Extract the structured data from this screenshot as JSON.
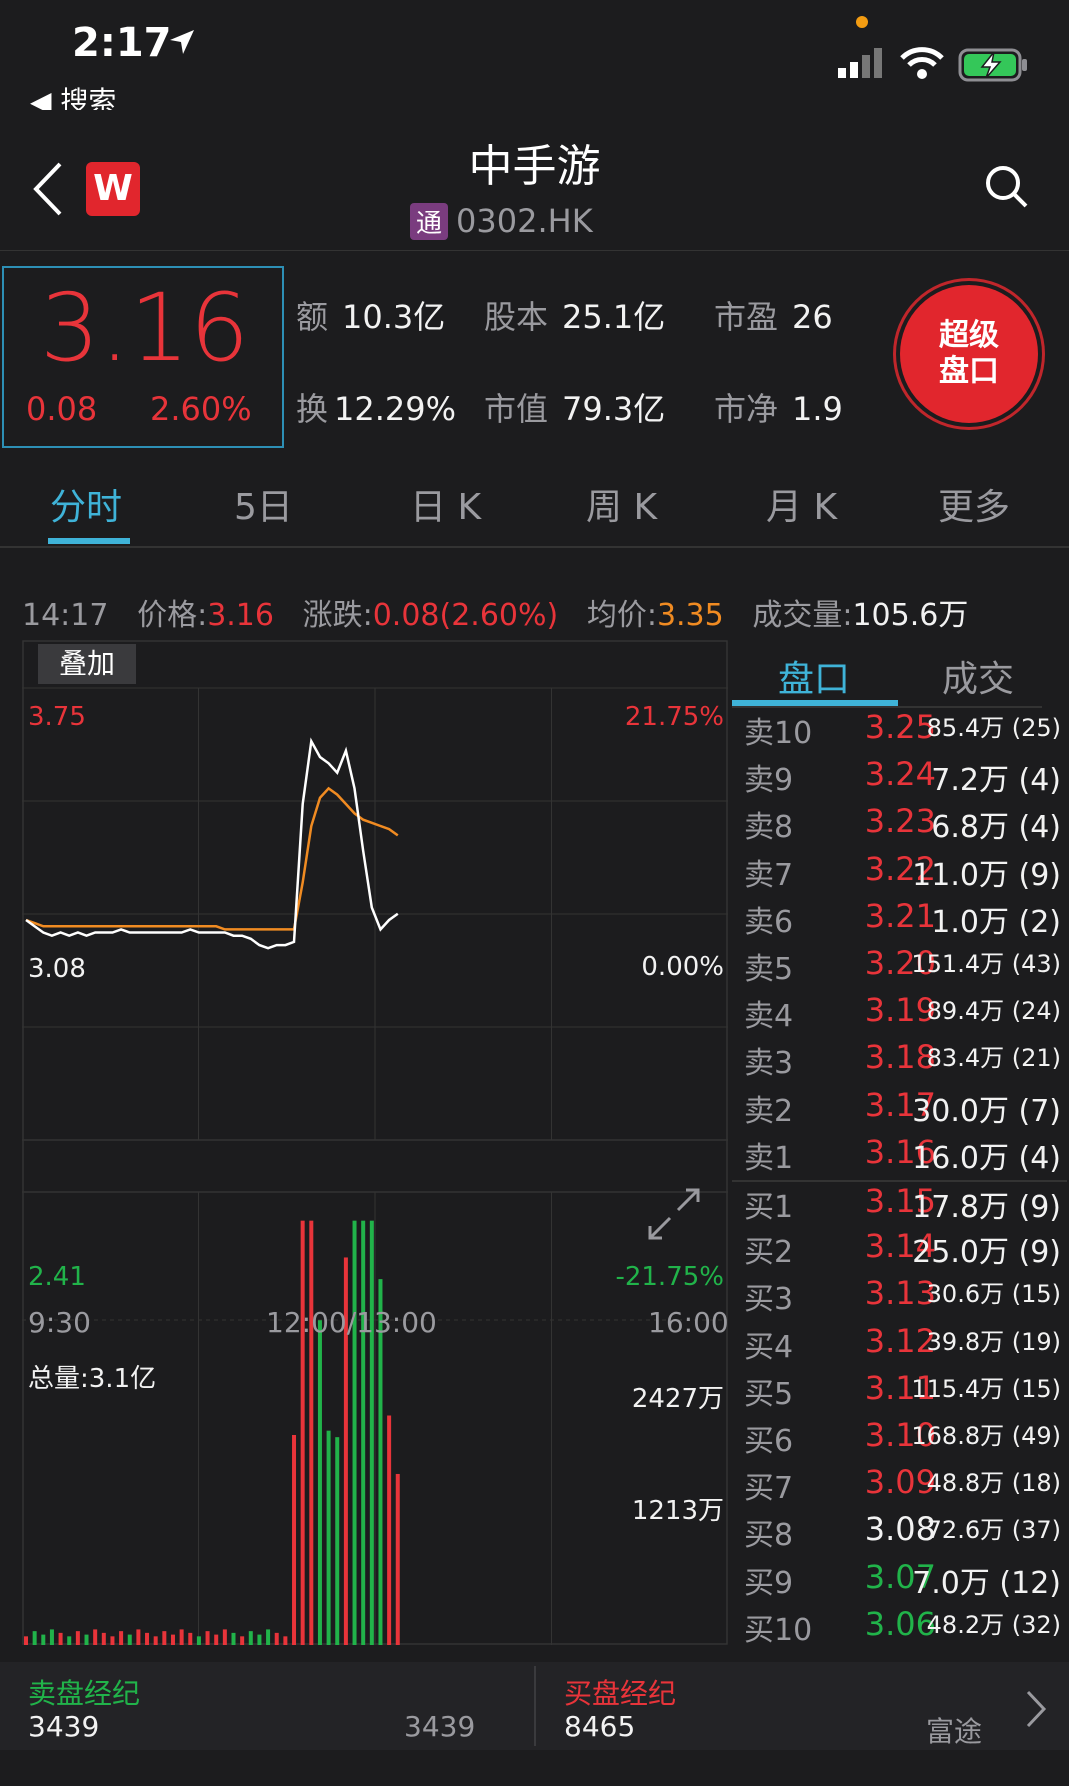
{
  "status": {
    "time": "2:17",
    "back_label": "◀ 搜索"
  },
  "header": {
    "title": "中手游",
    "badge": "通",
    "code": "0302.HK",
    "logo_letter": "W"
  },
  "quote": {
    "price": "3.16",
    "change": "0.08",
    "change_pct": "2.60%",
    "stats": [
      {
        "k": "额",
        "v": "10.3亿"
      },
      {
        "k": "股本",
        "v": "25.1亿"
      },
      {
        "k": "市盈",
        "v": "26"
      },
      {
        "k": "换",
        "v": "12.29%"
      },
      {
        "k": "市值",
        "v": "79.3亿"
      },
      {
        "k": "市净",
        "v": "1.9"
      }
    ],
    "super_button": "超级\n盘口"
  },
  "tabs": [
    "分时",
    "5日",
    "日 K",
    "周 K",
    "月 K",
    "更多"
  ],
  "infoline": {
    "time": "14:17",
    "price_label": "价格:",
    "price": "3.16",
    "chg_label": "涨跌:",
    "chg": "0.08(2.60%)",
    "avg_label": "均价:",
    "avg": "3.35",
    "vol_label": "成交量:",
    "vol": "105.6万"
  },
  "chart": {
    "overlay_label": "叠加",
    "y_top": "3.75",
    "y_mid": "3.08",
    "y_bot": "2.41",
    "pct_top": "21.75%",
    "pct_mid": "0.00%",
    "pct_bot": "-21.75%",
    "x_start": "9:30",
    "x_mid": "12:00/13:00",
    "x_end": "16:00",
    "vol_total": "总量:3.1亿",
    "vol_top": "2427万",
    "vol_mid": "1213万"
  },
  "chart_data": {
    "type": "line",
    "title": "",
    "xlabel": "",
    "ylabel": "",
    "ylim": [
      2.41,
      3.75
    ],
    "x_ticks": [
      "9:30",
      "12:00/13:00",
      "16:00"
    ],
    "series": [
      {
        "values": [
          3.08,
          3.06,
          3.04,
          3.03,
          3.04,
          3.03,
          3.04,
          3.03,
          3.04,
          3.04,
          3.04,
          3.05,
          3.04,
          3.04,
          3.04,
          3.04,
          3.04,
          3.04,
          3.04,
          3.05,
          3.04,
          3.04,
          3.04,
          3.04,
          3.03,
          3.03,
          3.02,
          3.0,
          2.99,
          3.0,
          3.0,
          3.01,
          3.45,
          3.65,
          3.6,
          3.58,
          3.55,
          3.62,
          3.5,
          3.3,
          3.12,
          3.05,
          3.08,
          3.1
        ]
      },
      {
        "values": [
          3.08,
          3.07,
          3.06,
          3.06,
          3.06,
          3.06,
          3.06,
          3.06,
          3.06,
          3.06,
          3.06,
          3.06,
          3.06,
          3.06,
          3.06,
          3.06,
          3.06,
          3.06,
          3.06,
          3.06,
          3.06,
          3.06,
          3.06,
          3.05,
          3.05,
          3.05,
          3.05,
          3.05,
          3.05,
          3.05,
          3.05,
          3.05,
          3.2,
          3.38,
          3.47,
          3.5,
          3.48,
          3.45,
          3.42,
          3.4,
          3.39,
          3.38,
          3.37,
          3.35
        ]
      }
    ],
    "volume": {
      "ylim": [
        0,
        2427
      ],
      "unit": "万"
    },
    "colors": {
      "price": "#ffffff",
      "avg": "#f08b22",
      "up": "#e8343a",
      "down": "#21b34a"
    }
  },
  "orderbook": {
    "tabs": [
      "盘口",
      "成交"
    ],
    "rows": [
      {
        "lbl": "卖10",
        "pr": "3.25",
        "vol": "85.4万 (25)",
        "c": "red",
        "small": true
      },
      {
        "lbl": "卖9",
        "pr": "3.24",
        "vol": "7.2万 (4)",
        "c": "red"
      },
      {
        "lbl": "卖8",
        "pr": "3.23",
        "vol": "6.8万 (4)",
        "c": "red"
      },
      {
        "lbl": "卖7",
        "pr": "3.22",
        "vol": "11.0万 (9)",
        "c": "red"
      },
      {
        "lbl": "卖6",
        "pr": "3.21",
        "vol": "1.0万 (2)",
        "c": "red"
      },
      {
        "lbl": "卖5",
        "pr": "3.20",
        "vol": "151.4万 (43)",
        "c": "red",
        "small": true
      },
      {
        "lbl": "卖4",
        "pr": "3.19",
        "vol": "89.4万 (24)",
        "c": "red",
        "small": true
      },
      {
        "lbl": "卖3",
        "pr": "3.18",
        "vol": "83.4万 (21)",
        "c": "red",
        "small": true
      },
      {
        "lbl": "卖2",
        "pr": "3.17",
        "vol": "30.0万 (7)",
        "c": "red"
      },
      {
        "lbl": "卖1",
        "pr": "3.16",
        "vol": "16.0万 (4)",
        "c": "red"
      },
      {
        "lbl": "买1",
        "pr": "3.15",
        "vol": "17.8万 (9)",
        "c": "red"
      },
      {
        "lbl": "买2",
        "pr": "3.14",
        "vol": "25.0万 (9)",
        "c": "red"
      },
      {
        "lbl": "买3",
        "pr": "3.13",
        "vol": "30.6万 (15)",
        "c": "red",
        "small": true
      },
      {
        "lbl": "买4",
        "pr": "3.12",
        "vol": "39.8万 (19)",
        "c": "red",
        "small": true
      },
      {
        "lbl": "买5",
        "pr": "3.11",
        "vol": "115.4万 (15)",
        "c": "red",
        "small": true
      },
      {
        "lbl": "买6",
        "pr": "3.10",
        "vol": "168.8万 (49)",
        "c": "red",
        "small": true
      },
      {
        "lbl": "买7",
        "pr": "3.09",
        "vol": "48.8万 (18)",
        "c": "red",
        "small": true
      },
      {
        "lbl": "买8",
        "pr": "3.08",
        "vol": "72.6万 (37)",
        "c": "white",
        "small": true
      },
      {
        "lbl": "买9",
        "pr": "3.07",
        "vol": "7.0万 (12)",
        "c": "green"
      },
      {
        "lbl": "买10",
        "pr": "3.06",
        "vol": "48.2万 (32)",
        "c": "green",
        "small": true
      }
    ]
  },
  "broker": {
    "sell_label": "卖盘经纪",
    "sell_id": "3439",
    "sell_id2": "3439",
    "buy_label": "买盘经纪",
    "buy_id": "8465",
    "buy_name": "富途"
  }
}
